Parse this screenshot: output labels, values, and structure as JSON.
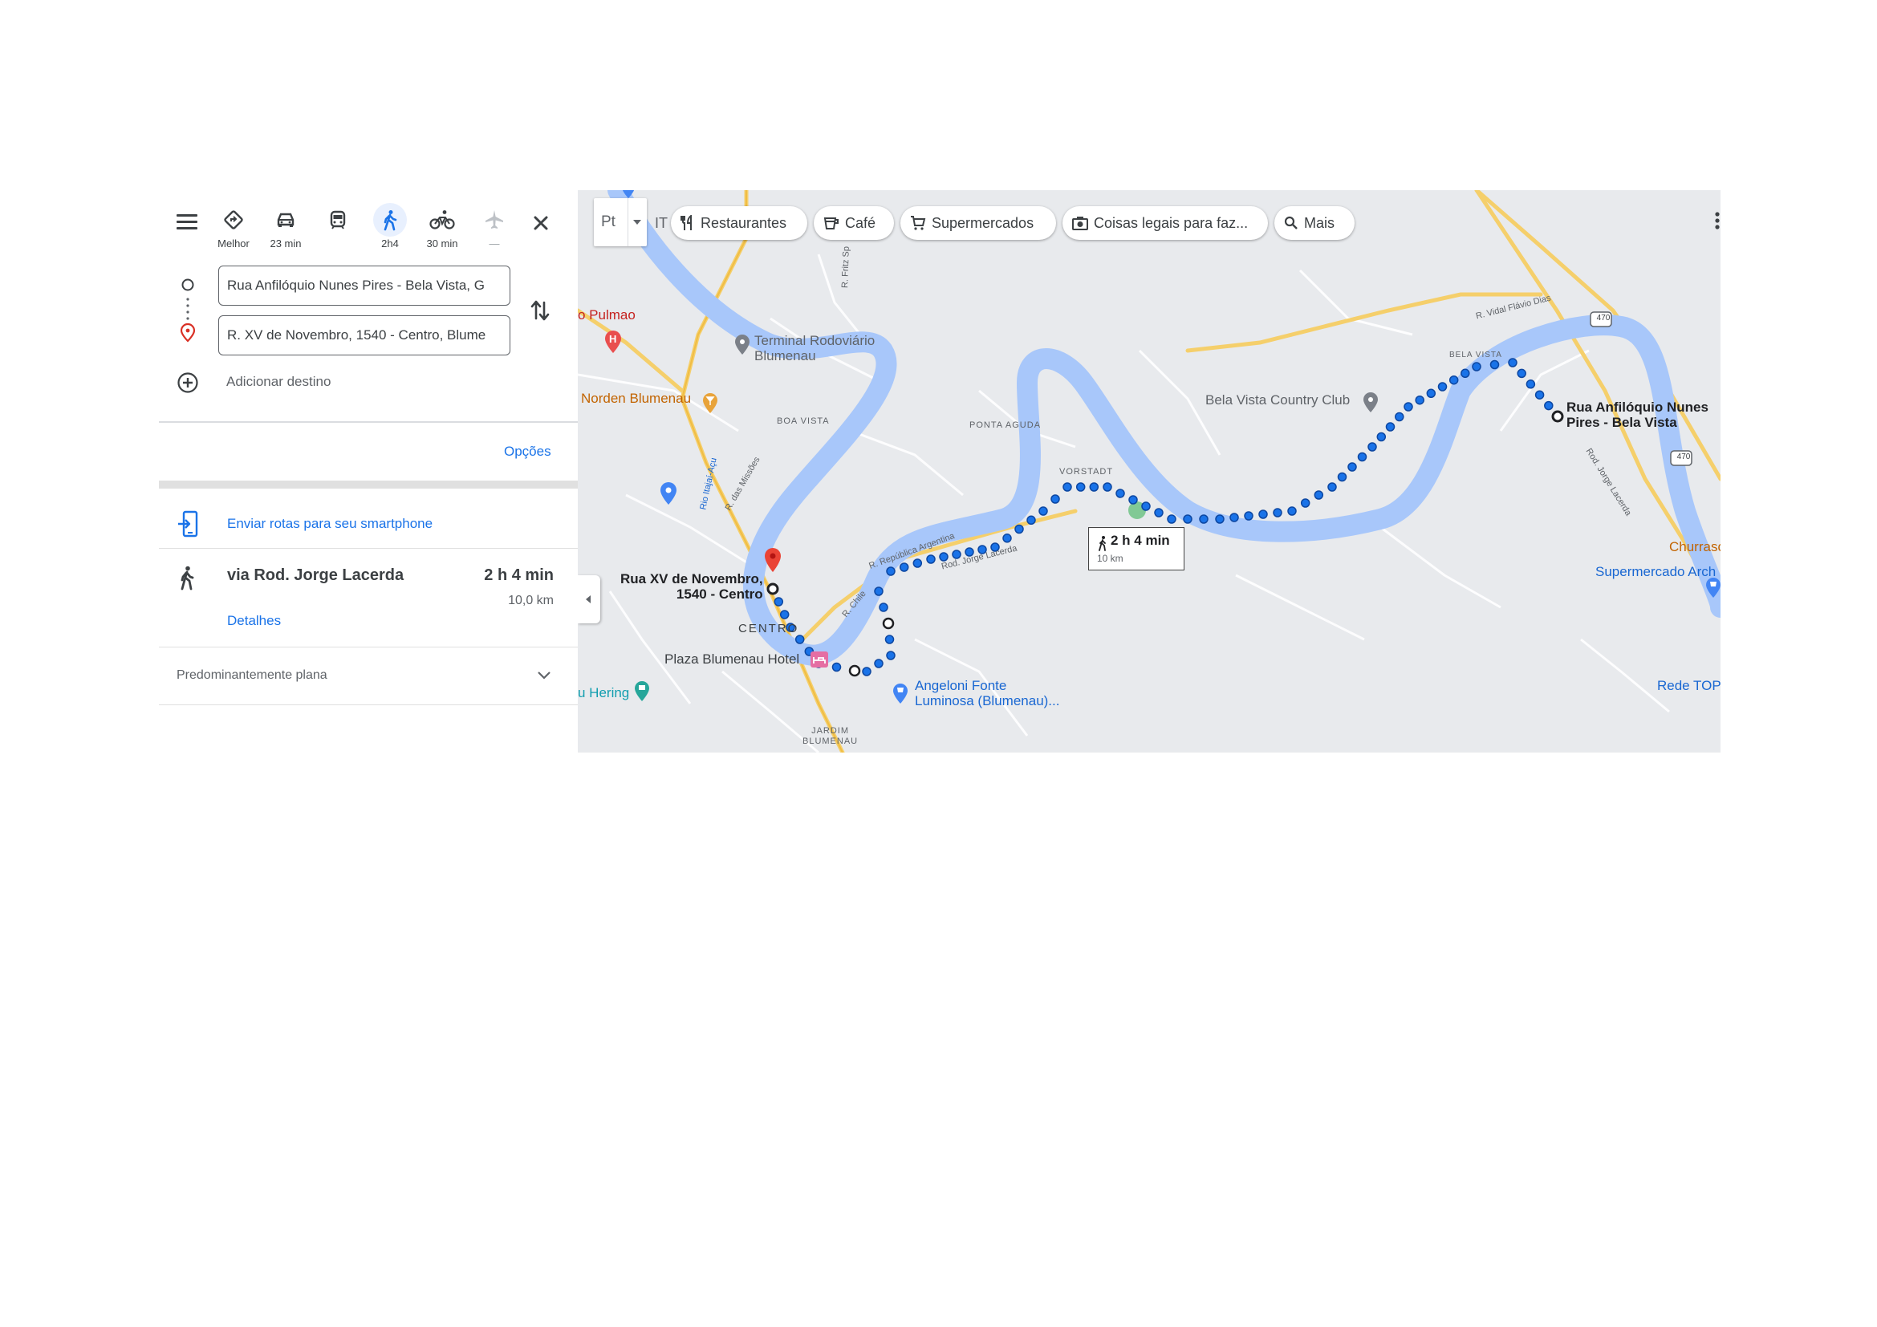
{
  "sidebar": {
    "menu_icon": "hamburger-menu-icon",
    "modes": [
      {
        "id": "best",
        "label": "Melhor",
        "icon": "route-diamond-icon"
      },
      {
        "id": "car",
        "label": "23 min",
        "icon": "car-icon"
      },
      {
        "id": "transit",
        "label": "",
        "icon": "train-icon"
      },
      {
        "id": "walk",
        "label": "2h4",
        "icon": "walking-icon",
        "active": true
      },
      {
        "id": "bike",
        "label": "30 min",
        "icon": "bicycle-icon"
      },
      {
        "id": "flight",
        "label": "—",
        "icon": "airplane-icon"
      }
    ],
    "origin_value": "Rua Anfilóquio Nunes Pires - Bela Vista, G",
    "destination_value": "R. XV de Novembro, 1540 - Centro, Blume",
    "add_destination": "Adicionar destino",
    "options": "Opções",
    "send_to_phone": "Enviar rotas para seu smartphone",
    "route": {
      "via": "via Rod. Jorge Lacerda",
      "duration": "2 h 4 min",
      "distance": "10,0 km",
      "details": "Detalhes"
    },
    "terrain": "Predominantemente plana"
  },
  "map": {
    "layer_button": "Pt",
    "filters": [
      {
        "label": "Restaurantes",
        "icon": "fork-knife-icon"
      },
      {
        "label": "Café",
        "icon": "coffee-cup-icon"
      },
      {
        "label": "Supermercados",
        "icon": "cart-icon"
      },
      {
        "label": "Coisas legais para faz...",
        "icon": "camera-icon"
      },
      {
        "label": "Mais",
        "icon": "search-icon"
      }
    ],
    "truncated_chip": "IT",
    "route_bubble": {
      "duration": "2 h 4 min",
      "distance": "10 km"
    },
    "origin_label": [
      "Rua Anfilóquio Nunes",
      "Pires - Bela Vista"
    ],
    "destination_label": [
      "Rua XV de Novembro,",
      "1540 - Centro"
    ],
    "places": {
      "terminal": [
        "Terminal Rodoviário",
        "Blumenau"
      ],
      "pulmao": "o Pulmao",
      "norden": "Norden Blumenau",
      "bela_vista_cc": "Bela Vista Country Club",
      "plaza": "Plaza Blumenau Hotel",
      "angeloni": [
        "Angeloni Fonte",
        "Luminosa (Blumenau)..."
      ],
      "hering": "u Hering",
      "supermercado_arch": "Supermercado Arch",
      "churrasc": "Churrasc",
      "rede_top": "Rede TOP"
    },
    "areas": {
      "boa_vista": "BOA VISTA",
      "ponta_aguda": "PONTA AGUDA",
      "vorstadt": "VORSTADT",
      "bela_vista": "BELA VISTA",
      "centro": "CENTRO",
      "jardim": [
        "JARDIM",
        "BLUMENAU"
      ]
    },
    "streets": {
      "vidal": "R. Vidal Flávio Dias",
      "republica": "R. República Argentina",
      "rod_jorge": "Rod. Jorge Lacerda",
      "rod_jorge_east": "Rod. Jorge Lacerda",
      "rio": "Rio Itajaí-Açu",
      "missoes": "R. das Missões",
      "fritz": "R. Fritz Sp",
      "chile": "R. Chile"
    },
    "highway_shields": [
      "470",
      "470"
    ],
    "colors": {
      "route": "#1a73e8",
      "water": "#a8c7fa",
      "road": "#f5cf6b",
      "accent": "#1a73e8"
    }
  }
}
